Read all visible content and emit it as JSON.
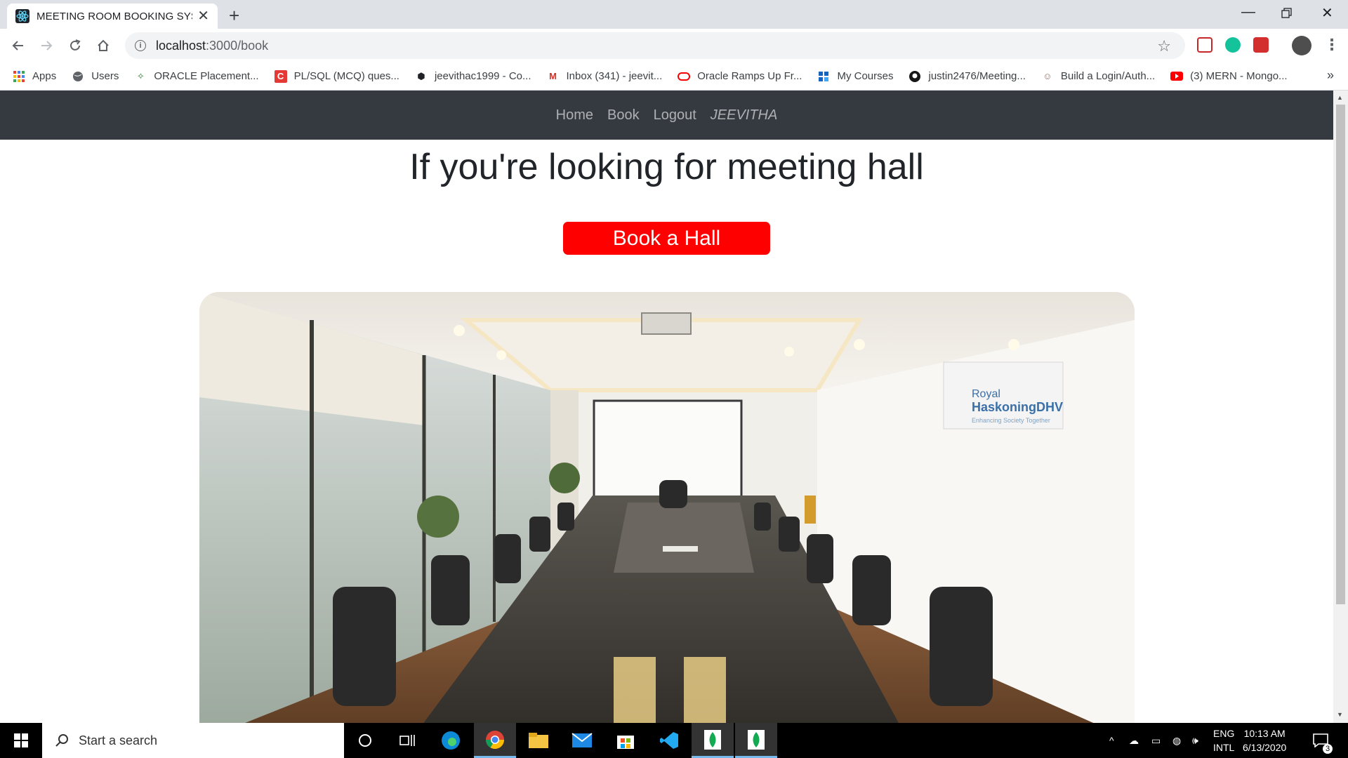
{
  "browser": {
    "tab_title": "MEETING ROOM BOOKING SYSTEM",
    "url_host": "localhost",
    "url_path": ":3000/book",
    "bookmarks": [
      {
        "label": "Apps",
        "icon": "apps-grid-icon"
      },
      {
        "label": "Users",
        "icon": "globe-icon"
      },
      {
        "label": "ORACLE Placement...",
        "icon": "oracle-leaf-icon"
      },
      {
        "label": "PL/SQL (MCQ) ques...",
        "icon": "c-logo-icon"
      },
      {
        "label": "jeevithac1999 - Co...",
        "icon": "cube-icon"
      },
      {
        "label": "Inbox (341) - jeevit...",
        "icon": "gmail-icon"
      },
      {
        "label": "Oracle Ramps Up Fr...",
        "icon": "oracle-ring-icon"
      },
      {
        "label": "My Courses",
        "icon": "courses-icon"
      },
      {
        "label": "justin2476/Meeting...",
        "icon": "github-icon"
      },
      {
        "label": "Build a Login/Auth...",
        "icon": "person-icon"
      },
      {
        "label": "(3) MERN - Mongo...",
        "icon": "youtube-icon"
      }
    ],
    "more_label": "»"
  },
  "page": {
    "nav": {
      "home": "Home",
      "book": "Book",
      "logout": "Logout",
      "user": "JEEVITHA"
    },
    "hero_title": "If you're looking for meeting hall",
    "book_button": "Book a Hall",
    "photo_sign_line1": "Royal",
    "photo_sign_line2": "HaskoningDHV",
    "photo_sign_line3": "Enhancing Society Together"
  },
  "taskbar": {
    "search_placeholder": "Start a search",
    "lang_line1": "ENG",
    "lang_line2": "INTL",
    "time": "10:13 AM",
    "date": "6/13/2020",
    "notification_count": "3"
  },
  "colors": {
    "navbar": "#343a40",
    "book_button": "#ff0000",
    "chrome_tabstrip": "#dee1e6"
  }
}
